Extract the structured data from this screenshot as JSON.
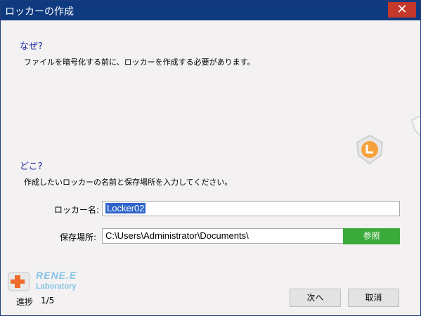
{
  "window": {
    "title": "ロッカーの作成",
    "close_glyph": "✕"
  },
  "why": {
    "heading": "なぜ?",
    "text": "ファイルを暗号化する前に、ロッカーを作成する必要があります。"
  },
  "where": {
    "heading": "どこ?",
    "text": "作成したいロッカーの名前と保存場所を入力してください。"
  },
  "form": {
    "name_label": "ロッカー名:",
    "name_value": "Locker02",
    "location_label": "保存場所:",
    "location_value": "C:\\Users\\Administrator\\Documents\\",
    "browse_label": "参照"
  },
  "footer": {
    "logo_name": "RENE.E",
    "logo_sub": "Laboratory",
    "progress_label": "進捗",
    "progress_value": "1/5",
    "next_label": "次へ",
    "cancel_label": "取消"
  },
  "colors": {
    "titlebar": "#0f3a80",
    "close": "#c4372b",
    "heading": "#1d2fa6",
    "browse": "#3aaa3a"
  }
}
